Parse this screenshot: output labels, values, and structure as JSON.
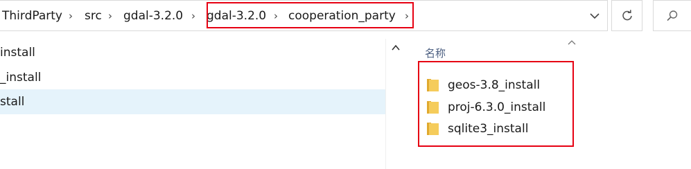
{
  "address_bar": {
    "breadcrumbs": [
      "ThirdParty",
      "src",
      "gdal-3.2.0",
      "gdal-3.2.0",
      "cooperation_party"
    ]
  },
  "toolbar": {
    "dropdown_icon": "chevron-down-icon",
    "refresh_icon": "refresh-icon",
    "search_icon": "search-icon"
  },
  "nav_pane": {
    "items": [
      {
        "label": "install",
        "selected": false
      },
      {
        "label": "_install",
        "selected": false
      },
      {
        "label": "stall",
        "selected": true
      }
    ]
  },
  "content": {
    "column_header": "名称",
    "files": [
      {
        "name": "geos-3.8_install",
        "icon": "folder-icon"
      },
      {
        "name": "proj-6.3.0_install",
        "icon": "folder-icon"
      },
      {
        "name": "sqlite3_install",
        "icon": "folder-icon"
      }
    ]
  },
  "colors": {
    "annotation_red": "#e60012",
    "selection": "#e5f3fb",
    "folder_yellow": "#f5cc5b",
    "header_text": "#4d6082"
  }
}
